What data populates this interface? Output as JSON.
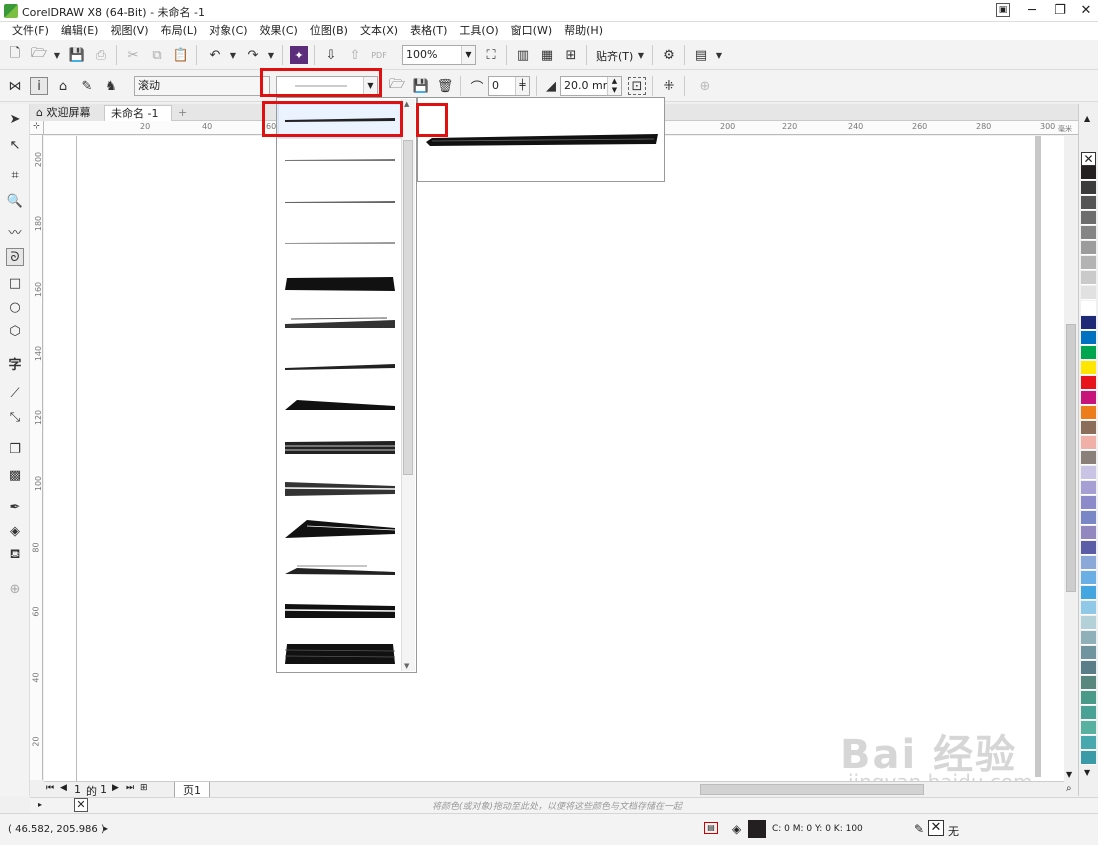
{
  "window": {
    "title": "CorelDRAW X8 (64-Bit) - 未命名 -1",
    "buttons": {
      "minimize": "─",
      "restore": "❐",
      "close": "✕"
    }
  },
  "menu": [
    "文件(F)",
    "编辑(E)",
    "视图(V)",
    "布局(L)",
    "对象(C)",
    "效果(C)",
    "位图(B)",
    "文本(X)",
    "表格(T)",
    "工具(O)",
    "窗口(W)",
    "帮助(H)"
  ],
  "std_toolbar": {
    "zoom": "100%",
    "snap_label": "贴齐(T)"
  },
  "prop_toolbar": {
    "preset_value": "滚动",
    "smoothing_value": "0",
    "width_value": "20.0 mm"
  },
  "doc_tabs": {
    "welcome": "欢迎屏幕",
    "doc": "未命名 -1",
    "add": "+"
  },
  "ruler": {
    "h_labels": [
      "20",
      "40",
      "60",
      "200",
      "220",
      "240",
      "260",
      "280",
      "300"
    ],
    "h_unit": "毫米",
    "v_labels": [
      "200",
      "180",
      "160",
      "140",
      "120",
      "100",
      "80",
      "60",
      "40",
      "20"
    ]
  },
  "page_nav": {
    "current": "1",
    "of": "的",
    "total": "1",
    "page_tab": "页1"
  },
  "hint": "将颜色(或对象)拖动至此处，以便将这些颜色与文档存储在一起",
  "status": {
    "coords": "( 46.582, 205.986 )",
    "fill_cmyk": "C: 0 M: 0 Y: 0 K: 100",
    "outline": "无"
  },
  "palette_colors": [
    "#231f20",
    "#3b3b3b",
    "#555555",
    "#6d6d6d",
    "#858585",
    "#9c9c9c",
    "#b3b3b3",
    "#cacaca",
    "#e1e1e1",
    "#ffffff",
    "#1e2a78",
    "#0070c0",
    "#00a64f",
    "#ffe600",
    "#e8141c",
    "#c8147a",
    "#ed7d1a",
    "#8c6d5a",
    "#f0b0a8",
    "#8b8079",
    "#c9c3e6",
    "#a69fd4",
    "#8c8acb",
    "#7a87c7",
    "#9287bf",
    "#5b5ea6",
    "#8aa8d8",
    "#6aaee6",
    "#44a6e0",
    "#90c8e8",
    "#b4d0d8",
    "#8fb0b8",
    "#7094a0",
    "#5b7d88",
    "#58877e",
    "#4a9a8a",
    "#4aa296",
    "#58b0a0",
    "#48a8b0",
    "#3a9aa8"
  ],
  "watermark": {
    "text": "Bai 经验",
    "url": "jingyan.baidu.com"
  }
}
